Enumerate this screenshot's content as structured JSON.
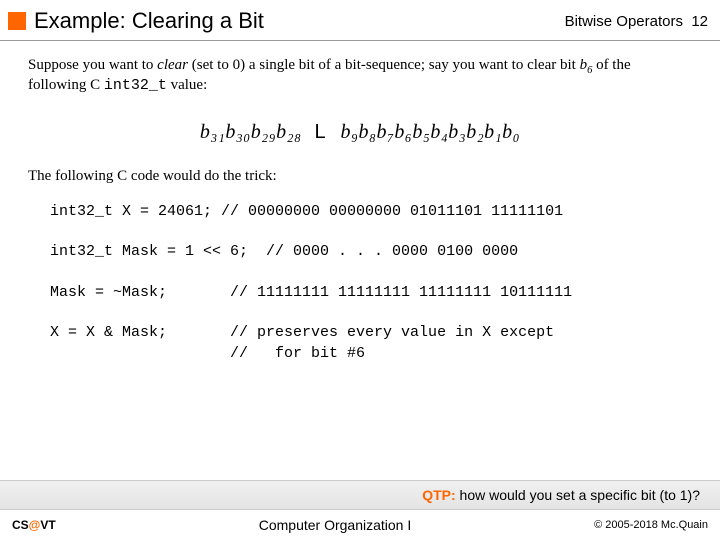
{
  "header": {
    "title": "Example: Clearing a Bit",
    "right_label": "Bitwise Operators",
    "page_no": "12"
  },
  "para1": {
    "t1": "Suppose you want to ",
    "em": "clear",
    "t2": " (set to 0) a single bit of a bit-sequence; say you want to clear bit ",
    "bitvar": "b",
    "bitidx": "6",
    "t3": " of the following C ",
    "code": "int32_t",
    "t4": " value:"
  },
  "bitseq": {
    "left": "b₃₁b₃₀b₂₉b₂₈",
    "gap": "L",
    "right": "b₉b₈b₇b₆b₅b₄b₃b₂b₁b₀"
  },
  "para2": "The following C code would do the trick:",
  "code": {
    "l1": "int32_t X = 24061; // 00000000 00000000 01011101 11111101",
    "b1": "",
    "l2": "int32_t Mask = 1 << 6;  // 0000 . . . 0000 0100 0000",
    "b2": "",
    "l3": "Mask = ~Mask;       // 11111111 11111111 11111111 10111111",
    "b3": "",
    "l4": "X = X & Mask;       // preserves every value in X except",
    "l5": "                    //   for bit #6"
  },
  "qtp": {
    "label": "QTP:",
    "text": "  how would you set a specific bit (to 1)?"
  },
  "footer": {
    "cs": "CS",
    "at": "@",
    "vt": "VT",
    "mid": "Computer Organization I",
    "right": "© 2005-2018 Mc.Quain"
  }
}
